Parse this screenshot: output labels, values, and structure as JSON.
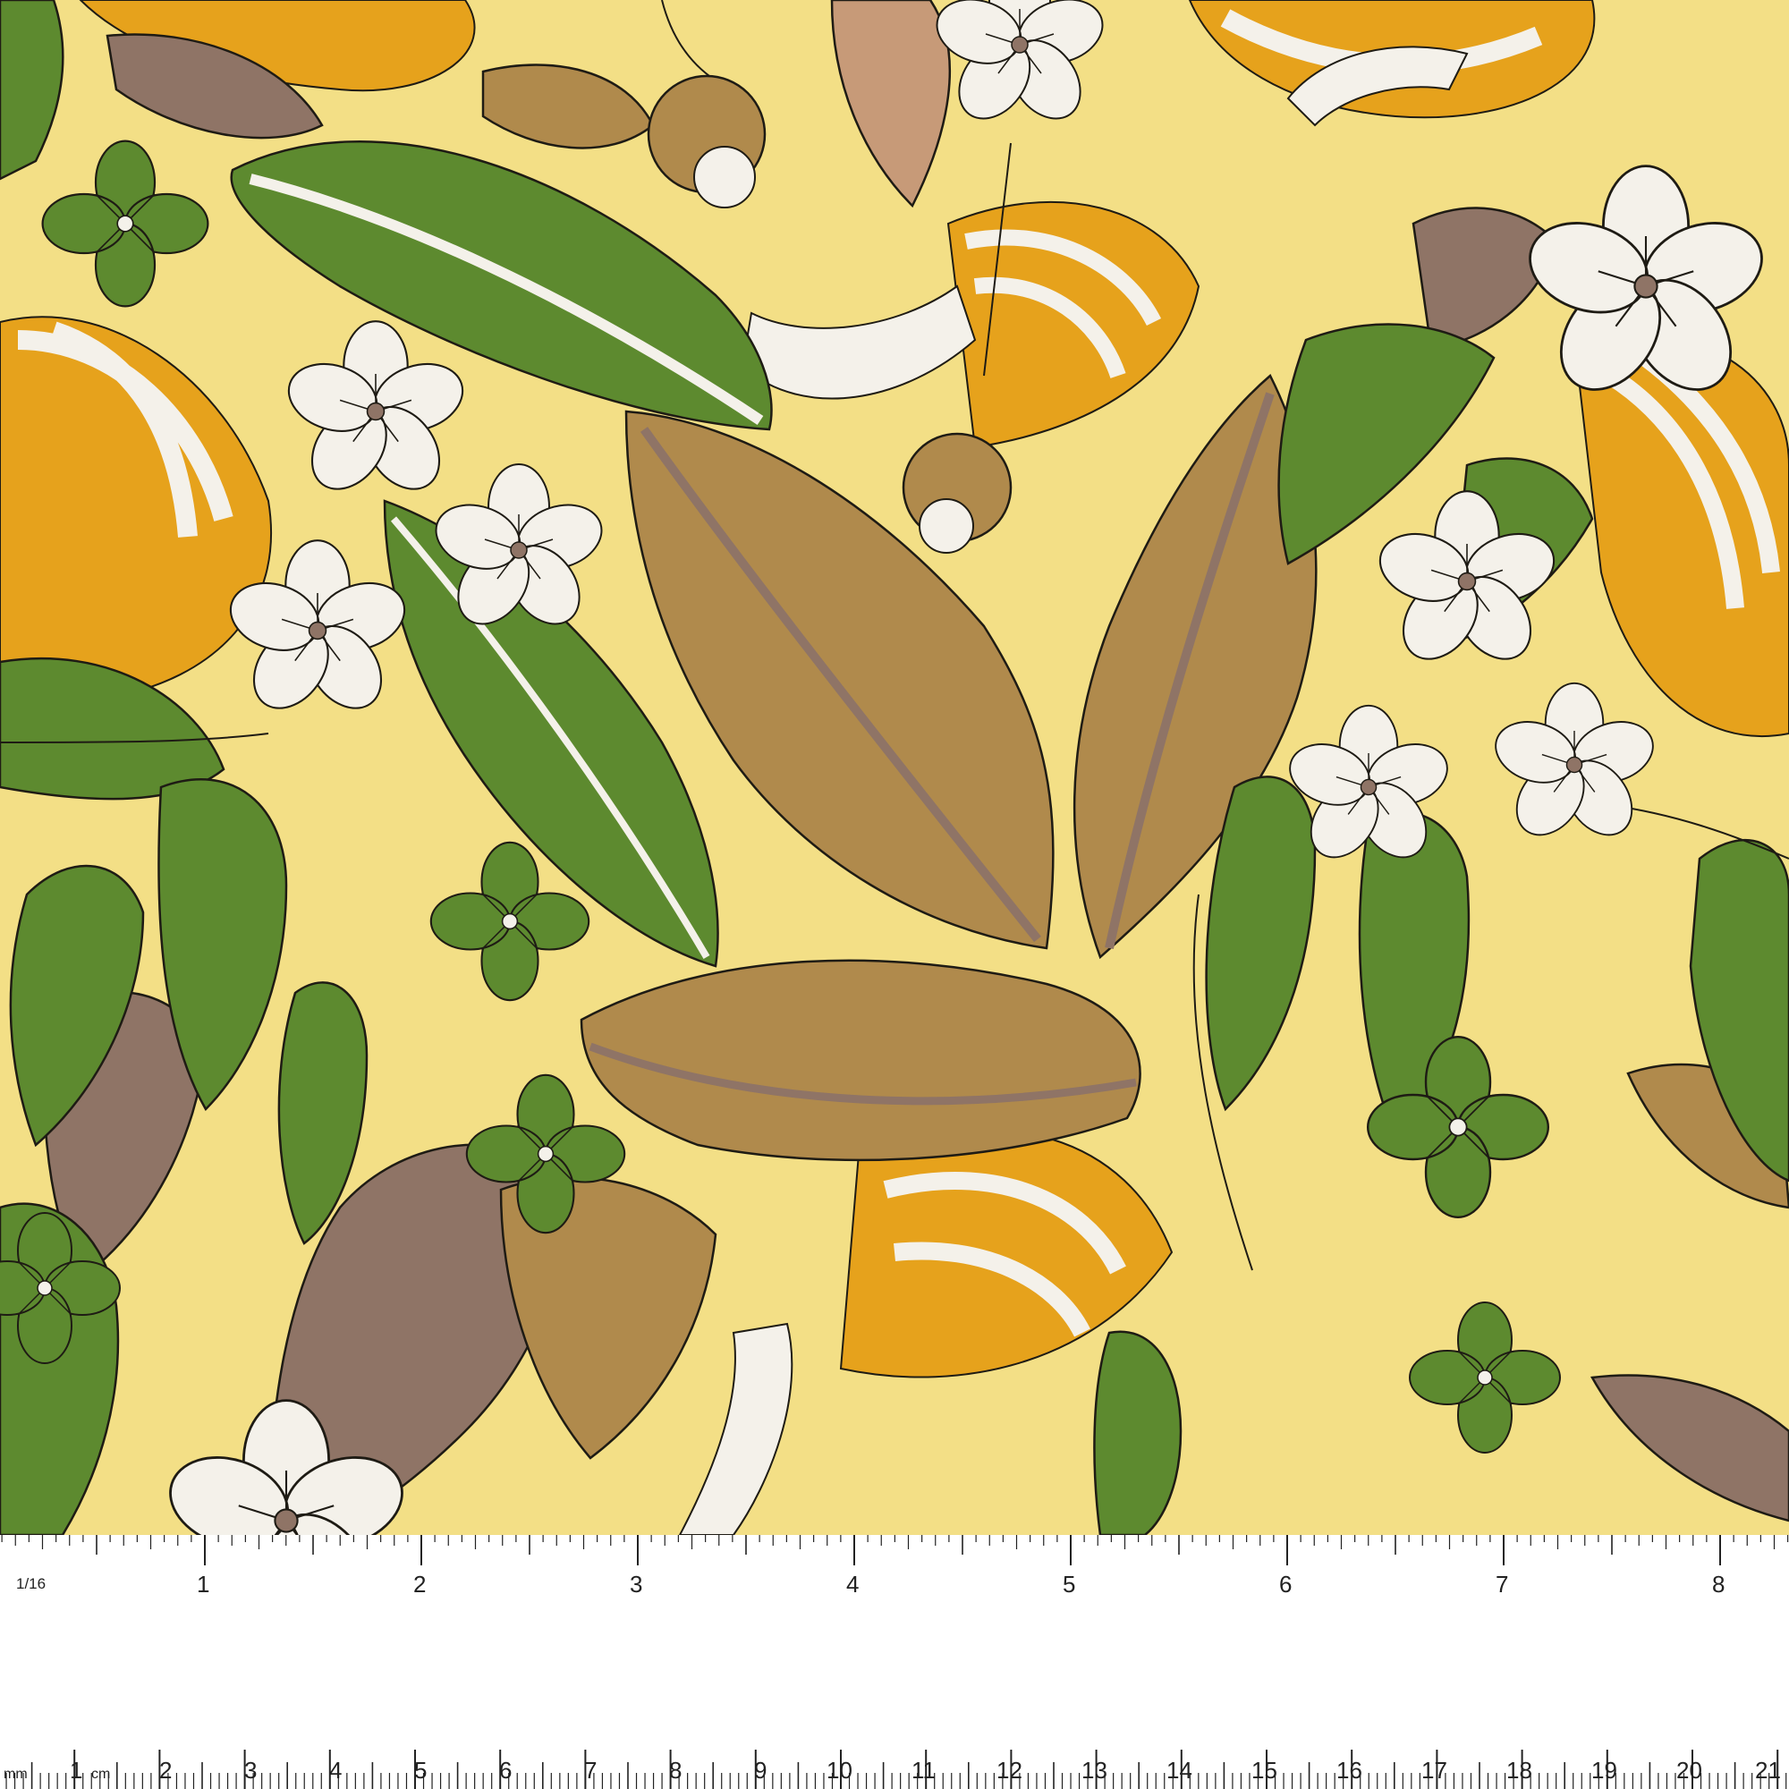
{
  "colors": {
    "background": "#f3df86",
    "leaf_green": "#5d8a2f",
    "leaf_tan": "#b08a4c",
    "leaf_mauve": "#8f7466",
    "petal_white": "#f4f1ea",
    "stripe_orange": "#e6a21c",
    "outline": "#1e1b14",
    "ruler_bg": "#ffffff",
    "ruler_ink": "#222222"
  },
  "inch_ruler": {
    "fraction_label": "1/16",
    "labels": [
      "1",
      "2",
      "3",
      "4",
      "5",
      "6",
      "7",
      "8"
    ]
  },
  "cm_ruler": {
    "unit_mm": "mm",
    "unit_cm": "cm",
    "labels": [
      "1",
      "2",
      "3",
      "4",
      "5",
      "6",
      "7",
      "8",
      "9",
      "10",
      "11",
      "12",
      "13",
      "14",
      "15",
      "16",
      "17",
      "18",
      "19",
      "20",
      "21"
    ]
  }
}
